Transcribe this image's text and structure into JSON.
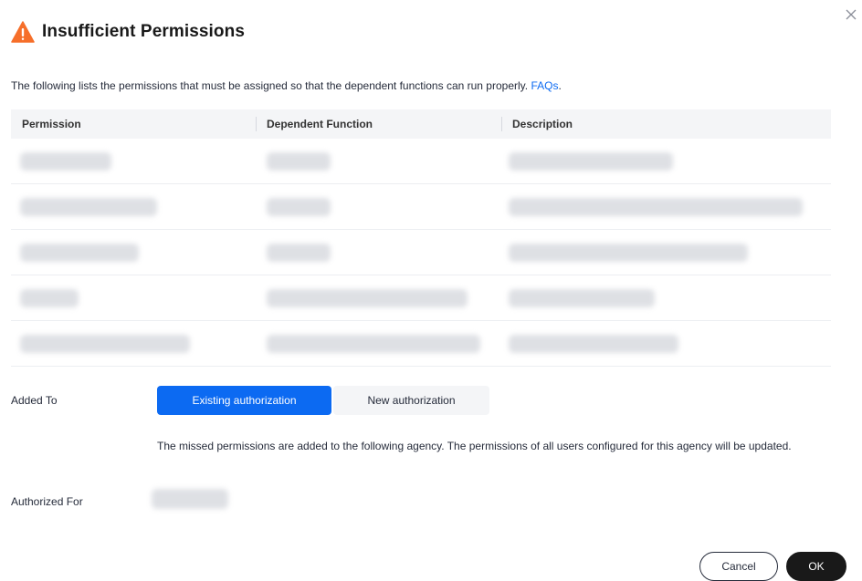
{
  "dialog": {
    "title": "Insufficient Permissions",
    "intro_text": "The following lists the permissions that must be assigned so that the dependent functions can run properly.",
    "intro_link": "FAQs",
    "intro_period": ".",
    "icons": {
      "warning": "warning-triangle-icon",
      "close": "close-icon"
    },
    "colors": {
      "accent": "#0c6af2",
      "warning": "#f66f2a",
      "primary_button": "#191919"
    }
  },
  "table": {
    "columns": [
      "Permission",
      "Dependent Function",
      "Description"
    ],
    "row_count": 5
  },
  "added_to": {
    "label": "Added To",
    "options": [
      "Existing authorization",
      "New authorization"
    ],
    "selected": "Existing authorization",
    "note": "The missed permissions are added to the following agency. The permissions of all users configured for this agency will be updated."
  },
  "authorized_for": {
    "label": "Authorized For"
  },
  "footer": {
    "cancel_label": "Cancel",
    "ok_label": "OK"
  }
}
